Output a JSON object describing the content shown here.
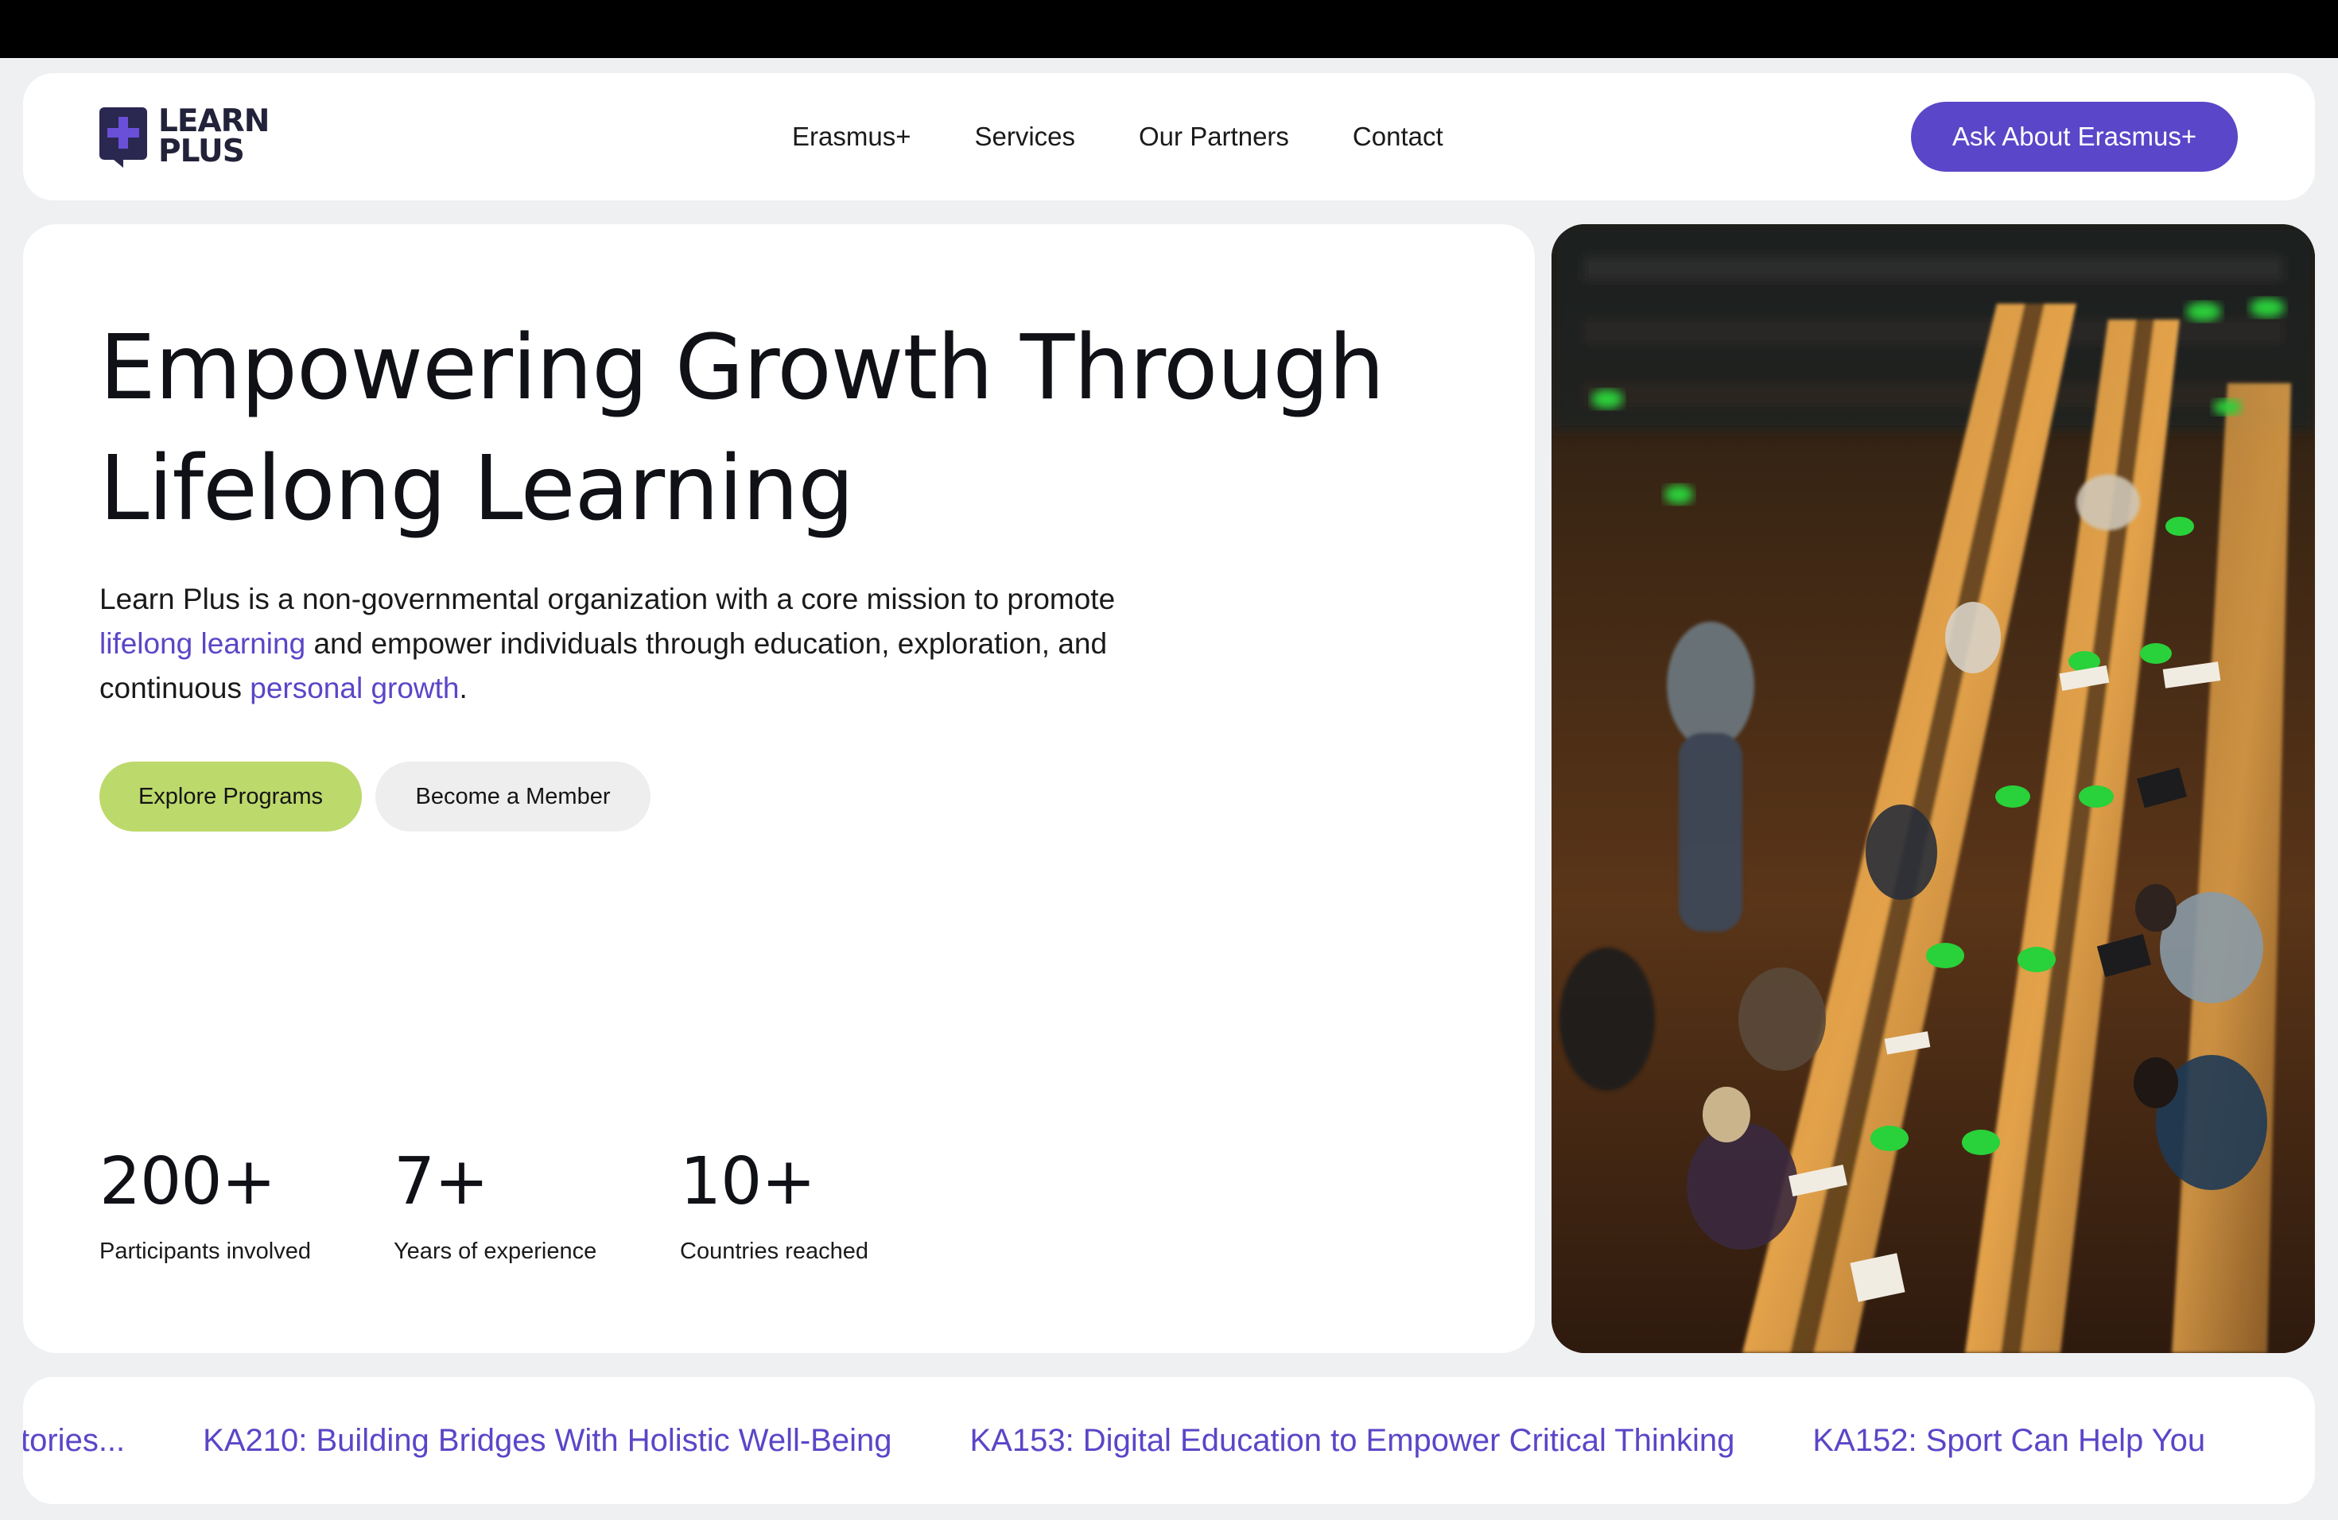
{
  "logo": {
    "line1": "LEARN",
    "line2": "PLUS"
  },
  "nav": {
    "links": [
      "Erasmus+",
      "Services",
      "Our Partners",
      "Contact"
    ],
    "cta": "Ask About Erasmus+"
  },
  "hero": {
    "title_line1": "Empowering Growth Through",
    "title_line2": "Lifelong Learning",
    "desc_part1": "Learn Plus is a non-governmental organization with a core mission to promote ",
    "desc_link1": "lifelong learning",
    "desc_part2": " and empower individuals through education, exploration, and continuous ",
    "desc_link2": "personal growth",
    "desc_part3": ".",
    "btn_primary": "Explore Programs",
    "btn_secondary": "Become a Member"
  },
  "stats": [
    {
      "value": "200+",
      "label": "Participants involved"
    },
    {
      "value": "7+",
      "label": "Years of experience"
    },
    {
      "value": "10+",
      "label": "Countries reached"
    }
  ],
  "ticker": {
    "items": [
      "tories...",
      "KA210: Building Bridges With Holistic Well-Being",
      "KA153: Digital Education to Empower Critical Thinking",
      "KA152: Sport Can Help You"
    ]
  },
  "colors": {
    "accent": "#5a46c8",
    "primary_button": "#bcd96b",
    "secondary_button": "#eeeeef",
    "page_background": "#eef0f2"
  },
  "image": {
    "description_icon": "library-photo"
  }
}
